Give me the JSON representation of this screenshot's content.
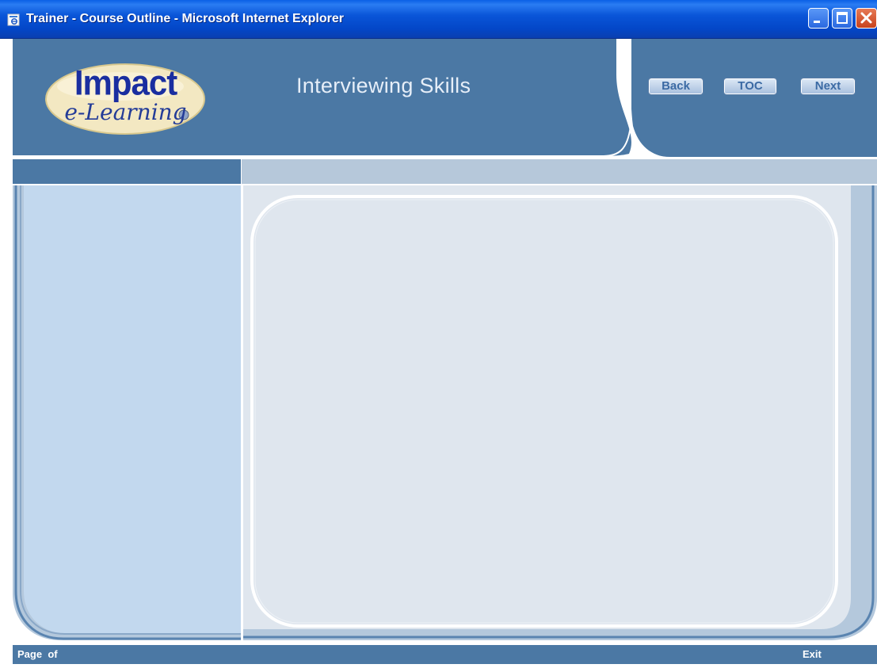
{
  "window": {
    "title": "Trainer - Course Outline - Microsoft Internet Explorer"
  },
  "header": {
    "logo_line1": "Impact",
    "logo_line2": "e-Learning",
    "course_title": "Interviewing Skills",
    "nav": {
      "back_label": "Back",
      "toc_label": "TOC",
      "next_label": "Next"
    }
  },
  "footer": {
    "page_label": "Page",
    "of_label": "of",
    "exit_label": "Exit"
  },
  "colors": {
    "header_blue": "#4b78a4",
    "sidebar_blue": "#c2d8ee",
    "content_bg": "#dfe6ee",
    "bar_light": "#b6c8da"
  }
}
